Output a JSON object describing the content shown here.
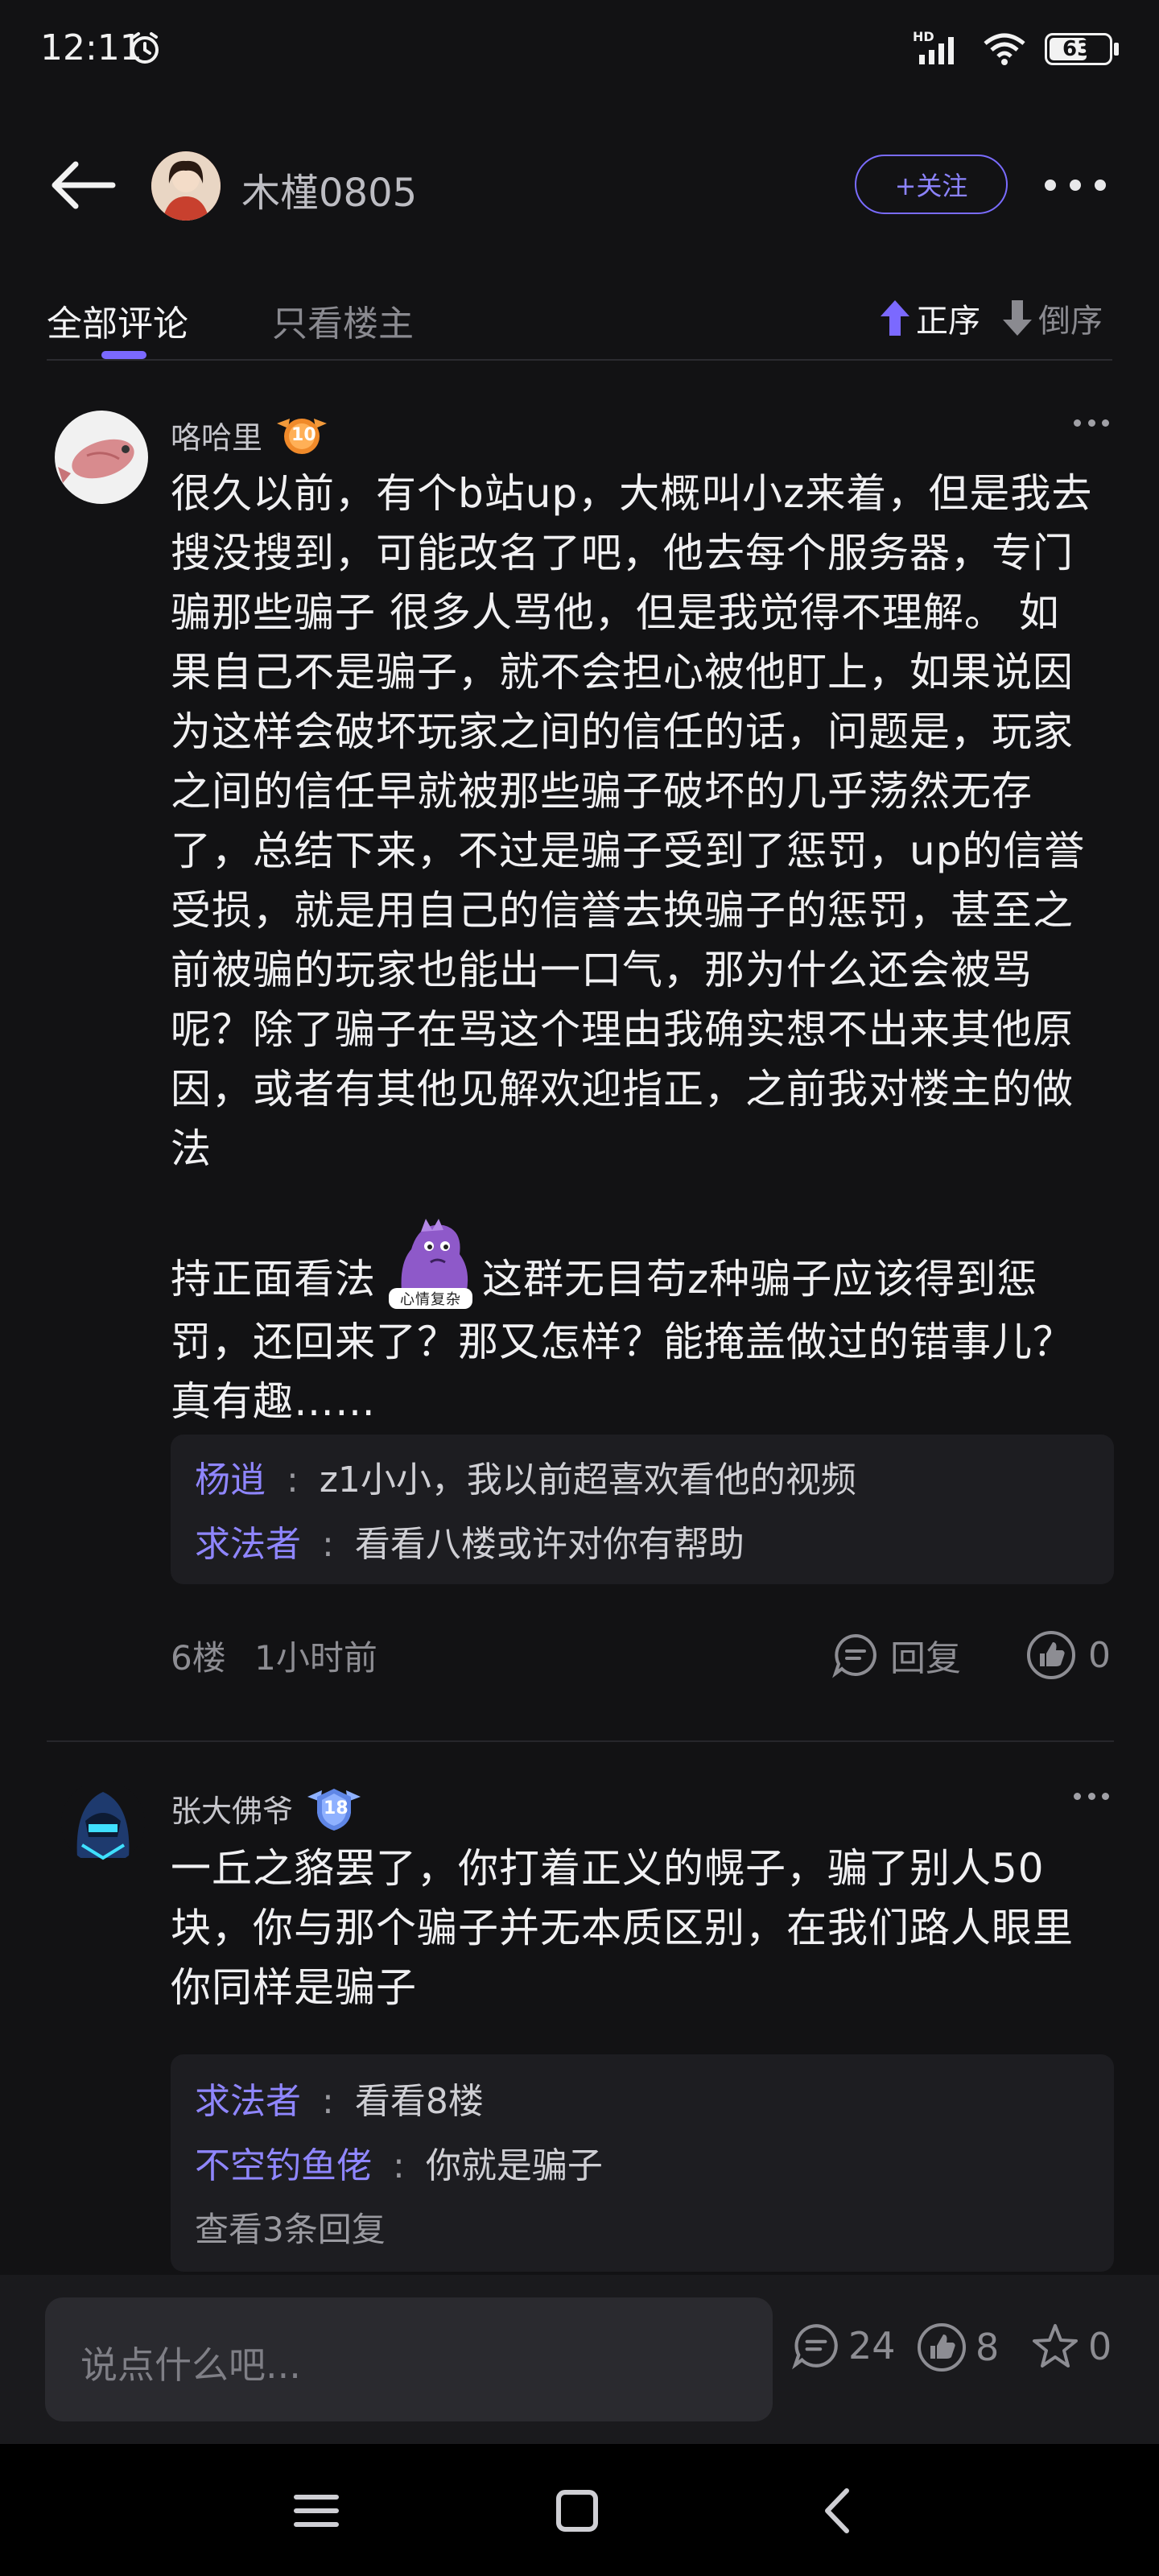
{
  "status_bar": {
    "time": "12:11",
    "network": "HD",
    "battery": "63"
  },
  "header": {
    "username": "木槿0805",
    "follow_label": "+关注"
  },
  "tabs": {
    "all": "全部评论",
    "host_only": "只看楼主",
    "sort_asc": "正序",
    "sort_desc": "倒序"
  },
  "comments": [
    {
      "user": "咯哈里",
      "level": "10",
      "text_part1": "很久以前，有个b站up，大概叫小z来着，但是我去搜没搜到，可能改名了吧，他去每个服务器，专门骗那些骗子 很多人骂他，但是我觉得不理解。 如果自己不是骗子，就不会担心被他盯上，如果说因为这样会破坏玩家之间的信任的话，问题是，玩家之间的信任早就被那些骗子破坏的几乎荡然无存了，总结下来，不过是骗子受到了惩罚，up的信誉受损，就是用自己的信誉去换骗子的惩罚，甚至之前被骗的玩家也能出一口气，那为什么还会被骂呢？除了骗子在骂这个理由我确实想不出来其他原因，或者有其他见解欢迎指正，之前我对楼主的做法",
      "text_part2_a": "持正面看法",
      "sticker_label": "心情复杂",
      "text_part2_b": "这群无目苟z种骗子应该得到惩罚，还回来了？那又怎样？能掩盖做过的错事儿？真有趣……",
      "replies": [
        {
          "user": "杨逍",
          "text": "z1小小，我以前超喜欢看他的视频"
        },
        {
          "user": "求法者",
          "text": "看看八楼或许对你有帮助"
        }
      ],
      "floor": "6楼",
      "time": "1小时前",
      "reply_label": "回复",
      "likes": "0"
    },
    {
      "user": "张大佛爷",
      "level": "18",
      "text": "一丘之貉罢了，你打着正义的幌子，骗了别人50块，你与那个骗子并无本质区别，在我们路人眼里你同样是骗子",
      "replies": [
        {
          "user": "求法者",
          "text": "看看8楼"
        },
        {
          "user": "不空钓鱼佬",
          "text": "你就是骗子"
        }
      ],
      "more_replies": "查看3条回复"
    }
  ],
  "bottom_bar": {
    "placeholder": "说点什么吧...",
    "comments": "24",
    "likes": "8",
    "stars": "0"
  },
  "colors": {
    "accent": "#7b69ff",
    "background": "#121214",
    "reply_name": "#8f86ff"
  }
}
